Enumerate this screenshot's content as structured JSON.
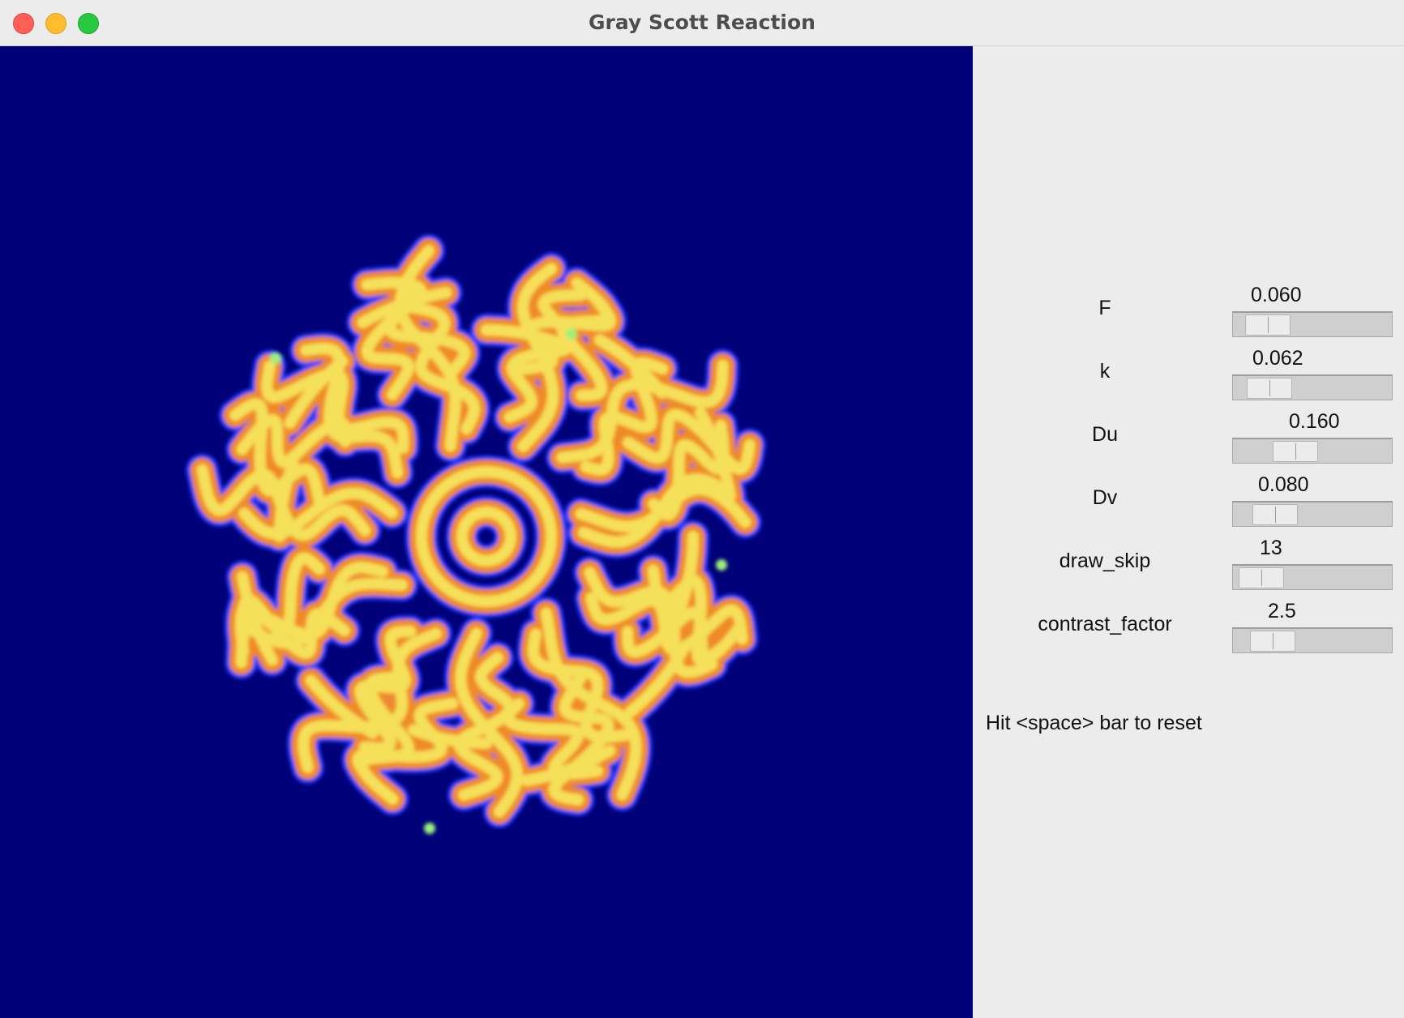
{
  "window": {
    "title": "Gray Scott Reaction"
  },
  "traffic_lights": {
    "close": "#fe5f57",
    "minimize": "#febc2e",
    "maximize": "#28c840"
  },
  "simulation": {
    "background_color": "#000078",
    "pattern_colors": [
      "#1a3cff",
      "#f08a28",
      "#f5e05a",
      "#9df07a"
    ]
  },
  "controls": {
    "F": {
      "label": "F",
      "value": "0.060",
      "slider_fraction": 0.08
    },
    "k": {
      "label": "k",
      "value": "0.062",
      "slider_fraction": 0.09
    },
    "Du": {
      "label": "Du",
      "value": "0.160",
      "slider_fraction": 0.32
    },
    "Dv": {
      "label": "Dv",
      "value": "0.080",
      "slider_fraction": 0.14
    },
    "draw_skip": {
      "label": "draw_skip",
      "value": "13",
      "slider_fraction": 0.02
    },
    "contrast_factor": {
      "label": "contrast_factor",
      "value": "2.5",
      "slider_fraction": 0.12
    }
  },
  "hint": "Hit <space> bar to reset"
}
